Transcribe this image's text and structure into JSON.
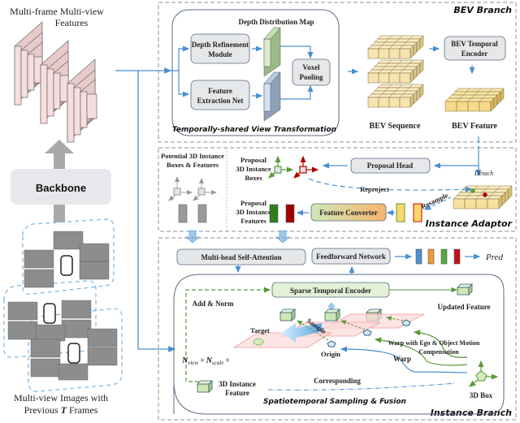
{
  "left_column": {
    "features_title_line1": "Multi-frame Multi-view",
    "features_title_line2": "Features",
    "backbone_label": "Backbone",
    "images_caption_line1": "Multi-view Images with",
    "images_caption_line2_prefix": "Previous ",
    "images_caption_line2_var": "T",
    "images_caption_line2_suffix": " Frames"
  },
  "bev_branch": {
    "title": "BEV Branch",
    "view_transform": {
      "title": "Temporally-shared View Transformation",
      "depth_map_label": "Depth Distribution Map",
      "depth_module_line1": "Depth Refinement",
      "depth_module_line2": "Module",
      "feature_net_line1": "Feature",
      "feature_net_line2": "Extraction Net",
      "voxel_line1": "Voxel",
      "voxel_line2": "Pooling"
    },
    "bev_sequence_label": "BEV Sequence",
    "temporal_encoder_line1": "BEV Temporal",
    "temporal_encoder_line2": "Encoder",
    "bev_feature_label": "BEV Feature"
  },
  "instance_adaptor": {
    "title": "Instance Adaptor",
    "potential_line1": "Potential 3D Instance",
    "potential_line2": "Boxes & Features",
    "proposal_boxes_line1": "Proposal",
    "proposal_boxes_line2": "3D Instance",
    "proposal_boxes_line3": "Boxes",
    "proposal_feat_line1": "Proposal",
    "proposal_feat_line2": "3D Instance",
    "proposal_feat_line3": "Features",
    "proposal_head": "Proposal Head",
    "feature_converter": "Feature Converter",
    "detach": "Detach",
    "reproject": "Reproject",
    "resample": "Resample"
  },
  "instance_branch": {
    "title": "Instance Branch",
    "self_attention": "Multi-head Self-Attention",
    "ffn": "Feedforward Network",
    "pred": "Pred",
    "sparse_encoder": "Sparse Temporal Encoder",
    "add_norm": "Add & Norm",
    "updated_feature": "Updated Feature",
    "sample": "Sample",
    "target": "Target",
    "origin": "Origin",
    "warp": "Warp",
    "warp_comp_line1": "Warp with Ego & Object Motion",
    "warp_comp_line2": "Compensation",
    "corresponding": "Corresponding",
    "instance_feature_line1": "3D Instance",
    "instance_feature_line2": "Feature",
    "box_3d": "3D Box",
    "n_view": "N",
    "n_view_sub": "view",
    "n_scale": "N",
    "n_scale_sub": "scale",
    "times": "×",
    "sampling_title": "Spatiotemporal Sampling & Fusion"
  },
  "colors": {
    "arrow_blue": "#4a8fd1",
    "dashed_border": "#8a9099",
    "box_fill": "#e6e7e9",
    "bev_cube": "#f6e3b0",
    "green_feature": "#2e7d1e",
    "red_feature": "#b00000",
    "pred_blue": "#4c8fd6",
    "pred_orange": "#ef9a3a",
    "pred_green": "#5aa645",
    "pred_red": "#c0111a"
  }
}
